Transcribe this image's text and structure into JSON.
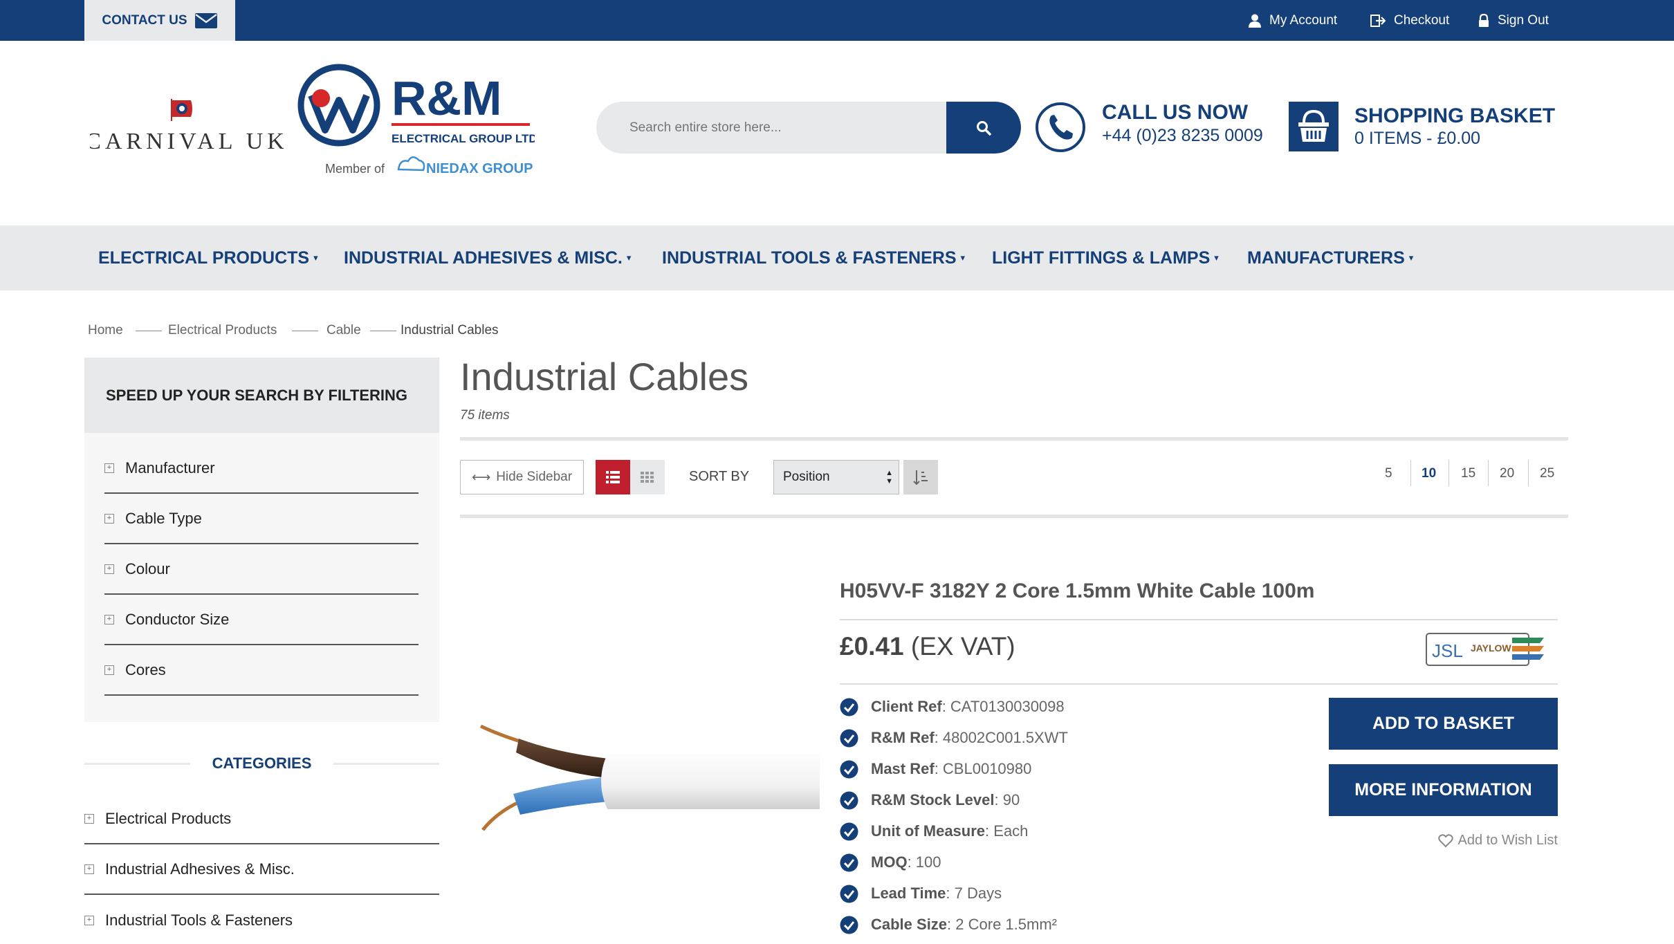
{
  "topbar": {
    "contact_label": "CONTACT US",
    "my_account": "My Account",
    "checkout": "Checkout",
    "sign_out": "Sign Out"
  },
  "header": {
    "carnival_logo_text": "CARNIVAL UK",
    "rm_logo_text": "R&M",
    "rm_logo_sub": "ELECTRICAL GROUP LTD",
    "member_of": "Member of",
    "niedax": "NIEDAX GROUP",
    "search_placeholder": "Search entire store here...",
    "call_title": "CALL US NOW",
    "call_number": "+44 (0)23 8235 0009",
    "basket_title": "SHOPPING BASKET",
    "basket_items": "0 ITEMS - £0.00"
  },
  "nav": [
    "ELECTRICAL PRODUCTS",
    "INDUSTRIAL ADHESIVES & MISC.",
    "INDUSTRIAL TOOLS & FASTENERS",
    "LIGHT FITTINGS & LAMPS",
    "MANUFACTURERS"
  ],
  "breadcrumb": [
    "Home",
    "Electrical Products",
    "Cable",
    "Industrial Cables"
  ],
  "sidebar": {
    "filter_title": "SPEED UP YOUR SEARCH BY FILTERING",
    "filters": [
      "Manufacturer",
      "Cable Type",
      "Colour",
      "Conductor Size",
      "Cores"
    ],
    "categories_title": "CATEGORIES",
    "categories": [
      "Electrical Products",
      "Industrial Adhesives & Misc.",
      "Industrial Tools & Fasteners"
    ]
  },
  "main": {
    "title": "Industrial Cables",
    "count": "75 items",
    "hide_sidebar": "Hide Sidebar",
    "sort_by": "SORT BY",
    "sort_value": "Position",
    "per_page": [
      "5",
      "10",
      "15",
      "20",
      "25"
    ],
    "per_page_selected": "10"
  },
  "product": {
    "name": "H05VV-F 3182Y 2 Core 1.5mm White Cable 100m",
    "price": "£0.41",
    "price_suffix": "(EX VAT)",
    "supplier_logo_text": "JSL",
    "supplier_logo_sub": "JAYLOW",
    "specs": [
      {
        "key": "Client Ref",
        "value": "CAT0130030098"
      },
      {
        "key": "R&M Ref",
        "value": "48002C001.5XWT"
      },
      {
        "key": "Mast Ref",
        "value": "CBL0010980"
      },
      {
        "key": "R&M Stock Level",
        "value": "90"
      },
      {
        "key": "Unit of Measure",
        "value": "Each"
      },
      {
        "key": "MOQ",
        "value": "100"
      },
      {
        "key": "Lead Time",
        "value": "7 Days"
      },
      {
        "key": "Cable Size",
        "value": "2 Core 1.5mm²"
      }
    ],
    "add_to_basket": "ADD TO BASKET",
    "more_information": "MORE INFORMATION",
    "add_to_wishlist": "Add to Wish List"
  },
  "colors": {
    "brand_navy": "#153f78",
    "accent_red": "#c0202e",
    "light_gray": "#e8e9ea"
  }
}
